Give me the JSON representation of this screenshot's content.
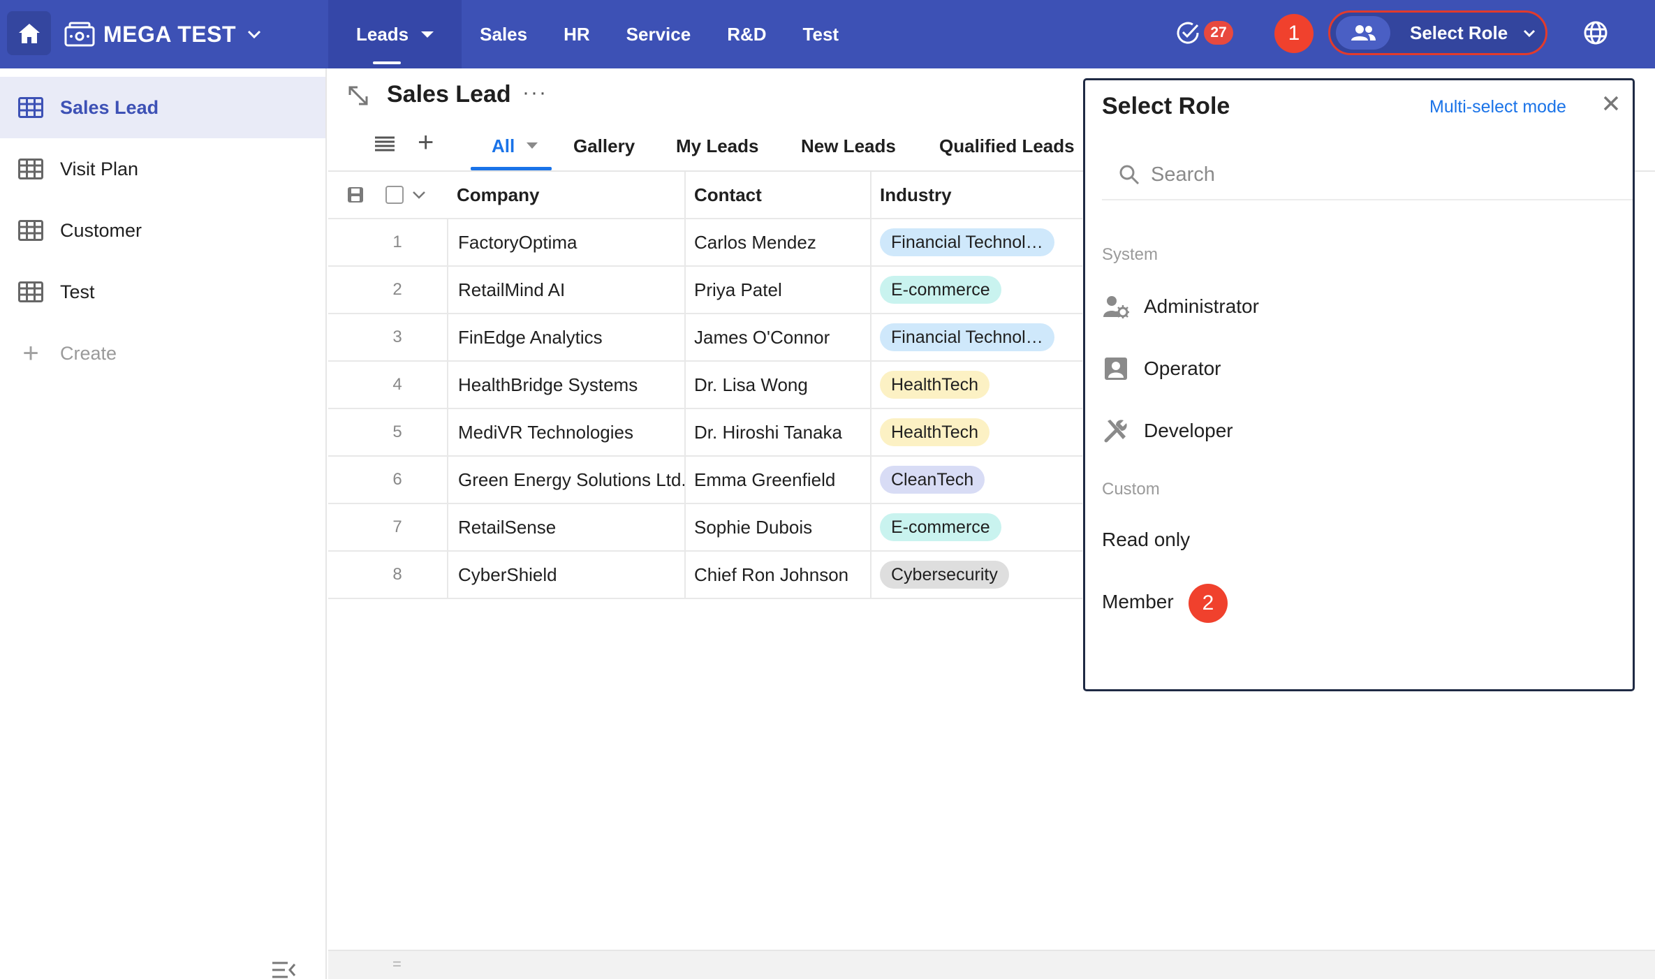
{
  "topbar": {
    "app_name": "MEGA TEST",
    "nav": [
      {
        "label": "Leads",
        "active": true
      },
      {
        "label": "Sales"
      },
      {
        "label": "HR"
      },
      {
        "label": "Service"
      },
      {
        "label": "R&D"
      },
      {
        "label": "Test"
      }
    ],
    "task_count": "27",
    "step_marker_1": "1",
    "role_button_label": "Select Role",
    "accent_color": "#3d51b5",
    "marker_color": "#f0412d"
  },
  "sidebar": {
    "items": [
      {
        "label": "Sales Lead",
        "icon": "table-icon",
        "active": true
      },
      {
        "label": "Visit Plan",
        "icon": "table-icon"
      },
      {
        "label": "Customer",
        "icon": "table-icon"
      },
      {
        "label": "Test",
        "icon": "table-icon"
      }
    ],
    "create_label": "Create"
  },
  "view": {
    "title": "Sales Lead",
    "more": "···",
    "tabs": [
      {
        "label": "All",
        "active": true
      },
      {
        "label": "Gallery"
      },
      {
        "label": "My Leads"
      },
      {
        "label": "New Leads"
      },
      {
        "label": "Qualified Leads"
      }
    ]
  },
  "table": {
    "columns": [
      "Company",
      "Contact",
      "Industry"
    ],
    "rows": [
      {
        "num": "1",
        "company": "FactoryOptima",
        "contact": "Carlos Mendez",
        "industry": "Financial Technol…",
        "tag_color": "#cfe8fb"
      },
      {
        "num": "2",
        "company": "RetailMind AI",
        "contact": "Priya Patel",
        "industry": "E-commerce",
        "tag_color": "#c9f3ef"
      },
      {
        "num": "3",
        "company": "FinEdge Analytics",
        "contact": "James O'Connor",
        "industry": "Financial Technol…",
        "tag_color": "#cfe8fb"
      },
      {
        "num": "4",
        "company": "HealthBridge Systems",
        "contact": "Dr. Lisa Wong",
        "industry": "HealthTech",
        "tag_color": "#fcf1c4"
      },
      {
        "num": "5",
        "company": "MediVR Technologies",
        "contact": "Dr. Hiroshi Tanaka",
        "industry": "HealthTech",
        "tag_color": "#fcf1c4"
      },
      {
        "num": "6",
        "company": "Green Energy Solutions Ltd.",
        "contact": "Emma Greenfield",
        "industry": "CleanTech",
        "tag_color": "#d8dcf5"
      },
      {
        "num": "7",
        "company": "RetailSense",
        "contact": "Sophie Dubois",
        "industry": "E-commerce",
        "tag_color": "#c9f3ef"
      },
      {
        "num": "8",
        "company": "CyberShield",
        "contact": "Chief Ron Johnson",
        "industry": "Cybersecurity",
        "tag_color": "#dedede"
      }
    ]
  },
  "role_panel": {
    "title": "Select Role",
    "multi_select_label": "Multi-select mode",
    "search_placeholder": "Search",
    "system_label": "System",
    "system_roles": [
      {
        "label": "Administrator",
        "icon": "admin-gear-icon"
      },
      {
        "label": "Operator",
        "icon": "operator-badge-icon"
      },
      {
        "label": "Developer",
        "icon": "tools-icon"
      }
    ],
    "custom_label": "Custom",
    "custom_roles": [
      {
        "label": "Read only"
      },
      {
        "label": "Member"
      }
    ],
    "step_marker_2": "2"
  }
}
